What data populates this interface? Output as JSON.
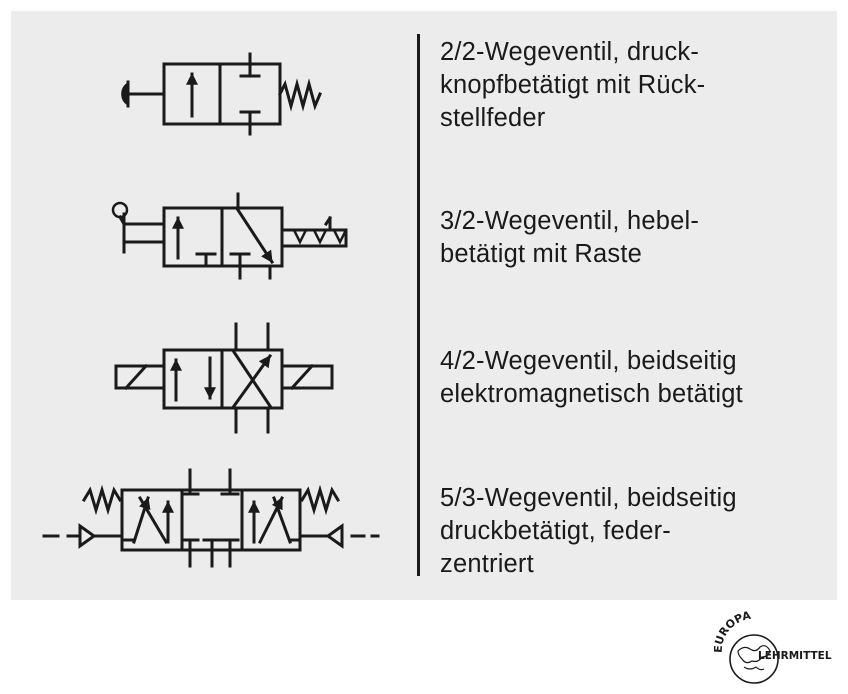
{
  "valves": [
    {
      "lines": [
        "2/2-Wegeventil, druck-",
        "knopfbetätigt mit Rück-",
        "stellfeder"
      ]
    },
    {
      "lines": [
        "3/2-Wegeventil, hebel-",
        "betätigt mit Raste"
      ]
    },
    {
      "lines": [
        "4/2-Wegeventil, beidseitig",
        "elektromagnetisch betätigt"
      ]
    },
    {
      "lines": [
        "5/3-Wegeventil, beidseitig",
        "druckbetätigt, feder-",
        "zentriert"
      ]
    }
  ],
  "logo": {
    "top_text": "EUROPA",
    "side_text": "LEHRMITTEL"
  },
  "colors": {
    "panel": "#ececec",
    "ink": "#1a1a1a",
    "page": "#ffffff"
  }
}
